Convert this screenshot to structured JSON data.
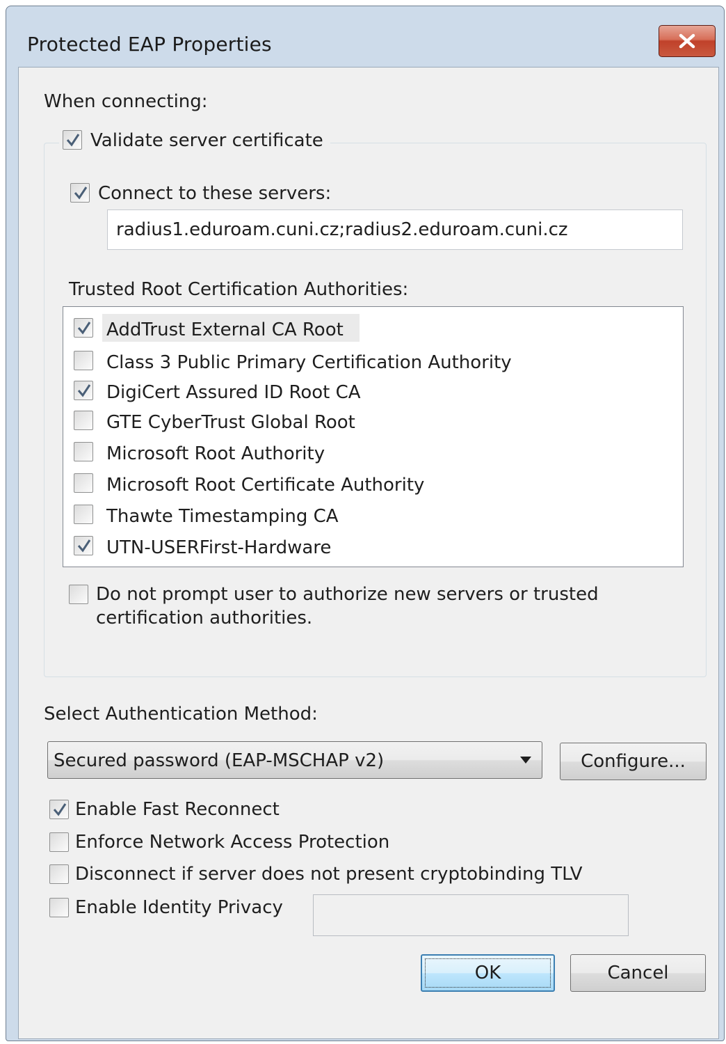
{
  "window": {
    "title": "Protected EAP Properties"
  },
  "connecting": {
    "heading": "When connecting:",
    "validate_cert": {
      "label": "Validate server certificate",
      "checked": true
    },
    "connect_servers": {
      "label": "Connect to these servers:",
      "checked": true
    },
    "servers_value": "radius1.eduroam.cuni.cz;radius2.eduroam.cuni.cz",
    "trusted_root_heading": "Trusted Root Certification Authorities:",
    "authorities": [
      {
        "label": "AddTrust External CA Root",
        "checked": true,
        "selected": true
      },
      {
        "label": "Class 3 Public Primary Certification Authority",
        "checked": false
      },
      {
        "label": "DigiCert Assured ID Root CA",
        "checked": true
      },
      {
        "label": "GTE CyberTrust Global Root",
        "checked": false
      },
      {
        "label": "Microsoft Root Authority",
        "checked": false
      },
      {
        "label": "Microsoft Root Certificate Authority",
        "checked": false
      },
      {
        "label": "Thawte Timestamping CA",
        "checked": false
      },
      {
        "label": "UTN-USERFirst-Hardware",
        "checked": true
      }
    ],
    "no_prompt": {
      "label_line1": "Do not prompt user to authorize new servers or trusted",
      "label_line2": "certification authorities.",
      "checked": false
    }
  },
  "auth": {
    "heading": "Select Authentication Method:",
    "method_selected": "Secured password (EAP-MSCHAP v2)",
    "configure_label": "Configure...",
    "options": [
      {
        "label": "Enable Fast Reconnect",
        "checked": true
      },
      {
        "label": "Enforce Network Access Protection",
        "checked": false
      },
      {
        "label": "Disconnect if server does not present cryptobinding TLV",
        "checked": false
      },
      {
        "label": "Enable Identity Privacy",
        "checked": false
      }
    ],
    "identity_value": ""
  },
  "footer": {
    "ok_label": "OK",
    "cancel_label": "Cancel"
  },
  "colors": {
    "titlebar": "#cddbea",
    "close_button": "#c9593f",
    "default_button": "#3c7fb1"
  },
  "icons": {
    "close": "close-icon",
    "check": "checkmark-icon",
    "dropdown": "chevron-down-icon"
  }
}
